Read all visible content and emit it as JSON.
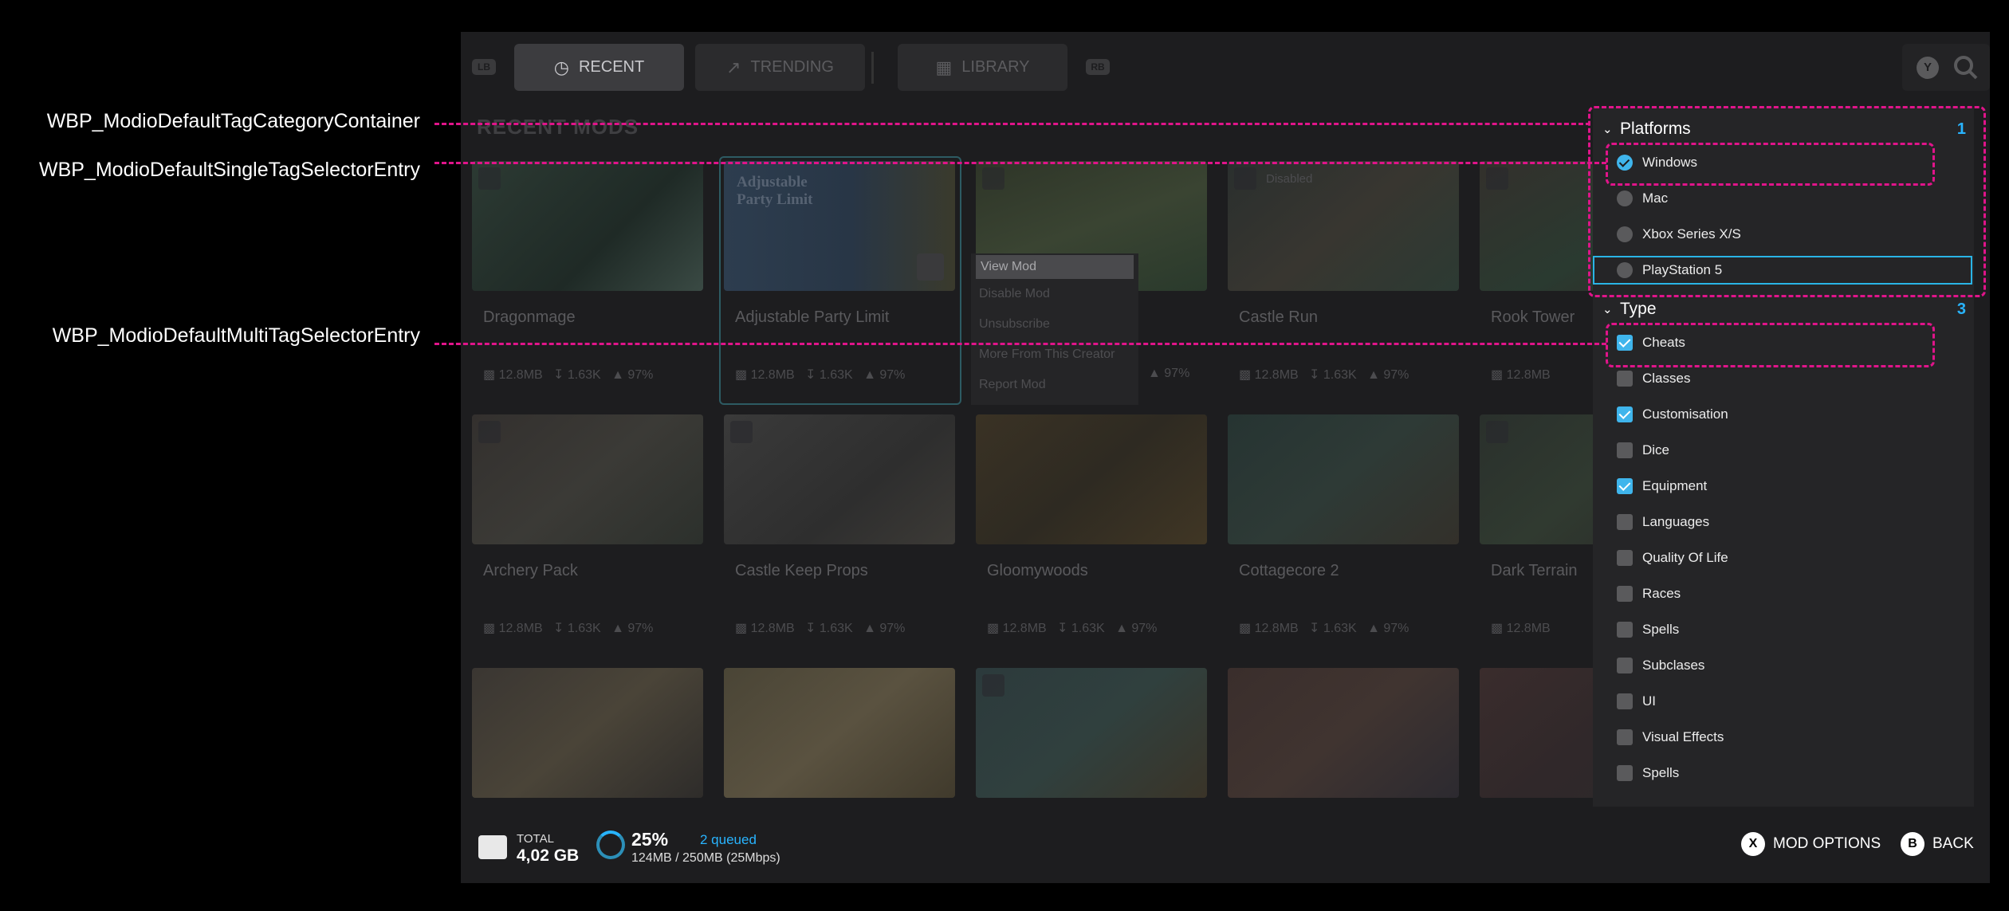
{
  "annotations": [
    {
      "label": "WBP_ModioDefaultTagCategoryContainer"
    },
    {
      "label": "WBP_ModioDefaultSingleTagSelectorEntry"
    },
    {
      "label": "WBP_ModioDefaultMultiTagSelectorEntry"
    }
  ],
  "topbar": {
    "lb": "LB",
    "rb": "RB",
    "y": "Y",
    "tabs": [
      {
        "label": "RECENT",
        "icon": "clock-icon"
      },
      {
        "label": "TRENDING",
        "icon": "trending-icon"
      },
      {
        "label": "LIBRARY",
        "icon": "library-icon"
      }
    ]
  },
  "section_title": "RECENT MODS",
  "cards": [
    {
      "title": "Dragonmage",
      "size": "12.8MB",
      "downloads": "1.63K",
      "rating": "97%"
    },
    {
      "title": "Adjustable Party Limit",
      "size": "12.8MB",
      "downloads": "1.63K",
      "rating": "97%",
      "thumb_text": "Adjustable Party Limit"
    },
    {
      "title": "",
      "size": "",
      "downloads": "",
      "rating": "97%"
    },
    {
      "title": "Castle Run",
      "size": "12.8MB",
      "downloads": "1.63K",
      "rating": "97%",
      "badge": "Disabled"
    },
    {
      "title": "Rook Tower",
      "size": "12.8MB",
      "downloads": "",
      "rating": ""
    },
    {
      "title": "Archery Pack",
      "size": "12.8MB",
      "downloads": "1.63K",
      "rating": "97%"
    },
    {
      "title": "Castle Keep Props",
      "size": "12.8MB",
      "downloads": "1.63K",
      "rating": "97%"
    },
    {
      "title": "Gloomywoods",
      "size": "12.8MB",
      "downloads": "1.63K",
      "rating": "97%"
    },
    {
      "title": "Cottagecore 2",
      "size": "12.8MB",
      "downloads": "1.63K",
      "rating": "97%"
    },
    {
      "title": "Dark Terrain",
      "size": "12.8MB",
      "downloads": "",
      "rating": ""
    }
  ],
  "context_menu": [
    "View Mod",
    "Disable Mod",
    "Unsubscribe",
    "More From This Creator",
    "Report Mod"
  ],
  "footer": {
    "total_label": "TOTAL",
    "total_value": "4,02 GB",
    "progress_percent": "25%",
    "queued": "2 queued",
    "transfer": "124MB / 250MB (25Mbps)",
    "mod_options_key": "X",
    "mod_options_label": "MOD OPTIONS",
    "back_key": "B",
    "back_label": "BACK"
  },
  "filters": {
    "platforms": {
      "name": "Platforms",
      "count": "1",
      "entries": [
        {
          "label": "Windows",
          "selected": true
        },
        {
          "label": "Mac",
          "selected": false
        },
        {
          "label": "Xbox Series X/S",
          "selected": false
        },
        {
          "label": "PlayStation 5",
          "selected": false
        }
      ]
    },
    "type": {
      "name": "Type",
      "count": "3",
      "entries": [
        {
          "label": "Cheats",
          "selected": true
        },
        {
          "label": "Classes",
          "selected": false
        },
        {
          "label": "Customisation",
          "selected": true
        },
        {
          "label": "Dice",
          "selected": false
        },
        {
          "label": "Equipment",
          "selected": true
        },
        {
          "label": "Languages",
          "selected": false
        },
        {
          "label": "Quality Of Life",
          "selected": false
        },
        {
          "label": "Races",
          "selected": false
        },
        {
          "label": "Spells",
          "selected": false
        },
        {
          "label": "Subclases",
          "selected": false
        },
        {
          "label": "UI",
          "selected": false
        },
        {
          "label": "Visual Effects",
          "selected": false
        },
        {
          "label": "Spells",
          "selected": false
        }
      ]
    }
  },
  "colors": {
    "accent": "#28b4ff",
    "annotation": "#e0148a",
    "panel": "#252527"
  }
}
